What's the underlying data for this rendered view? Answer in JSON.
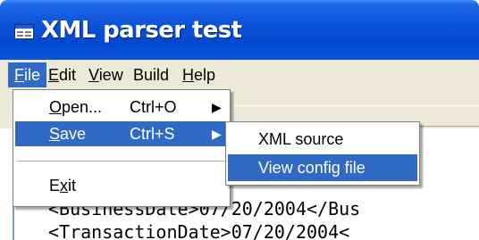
{
  "window": {
    "title": "XML parser test",
    "icon": "app-window-icon"
  },
  "menubar": {
    "items": [
      {
        "label": "File",
        "mnemonic": "F",
        "rest": "ile",
        "active": true
      },
      {
        "label": "Edit",
        "mnemonic": "E",
        "rest": "dit"
      },
      {
        "label": "View",
        "mnemonic": "V",
        "rest": "iew"
      },
      {
        "label": "Build"
      },
      {
        "label": "Help",
        "mnemonic": "H",
        "rest": "elp"
      }
    ]
  },
  "file_menu": {
    "items": [
      {
        "label_mn": "O",
        "label_rest": "pen...",
        "shortcut": "Ctrl+O",
        "arrow": "▶",
        "highlighted": false
      },
      {
        "label_mn": "S",
        "label_rest": "ave",
        "shortcut": "Ctrl+S",
        "arrow": "▶",
        "highlighted": true
      },
      {
        "label_pre": "E",
        "label_mn": "x",
        "label_rest": "it"
      }
    ]
  },
  "save_submenu": {
    "items": [
      {
        "label": "XML source",
        "highlighted": false
      },
      {
        "label": "View config file",
        "highlighted": true
      }
    ]
  },
  "editor": {
    "lines": [
      "<BusinessDate>07/20/2004</Bus",
      "<TransactionDate>07/20/2004<"
    ]
  },
  "colors": {
    "titlebar": "#0a50d8",
    "menu_highlight": "#316ac5",
    "chrome": "#ece9d8"
  }
}
